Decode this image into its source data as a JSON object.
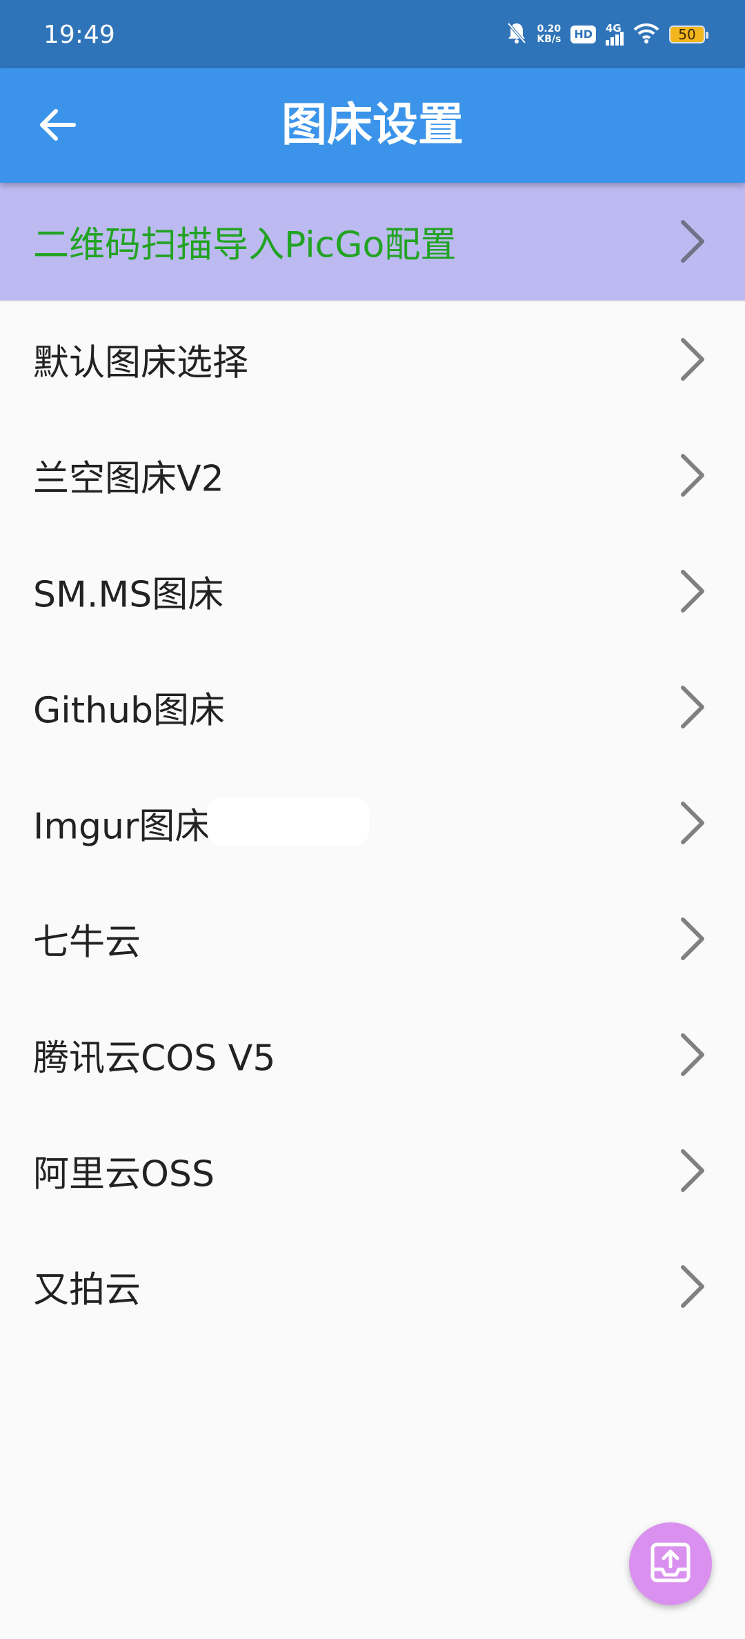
{
  "status_bar": {
    "time": "19:49",
    "net_speed_value": "0.20",
    "net_speed_unit": "KB/s",
    "hd_label": "HD",
    "signal_label": "4G",
    "battery_level": "50",
    "icons": [
      "mute-bell-icon",
      "hd-icon",
      "signal-icon",
      "wifi-icon",
      "battery-icon"
    ]
  },
  "app_bar": {
    "title": "图床设置",
    "back_icon": "back-arrow-icon"
  },
  "list": {
    "items": [
      {
        "label": "二维码扫描导入PicGo配置",
        "highlight": true
      },
      {
        "label": "默认图床选择"
      },
      {
        "label": "兰空图床V2"
      },
      {
        "label": "SM.MS图床"
      },
      {
        "label": "Github图床"
      },
      {
        "label": "Imgur图床"
      },
      {
        "label": "七牛云"
      },
      {
        "label": "腾讯云COS V5"
      },
      {
        "label": "阿里云OSS"
      },
      {
        "label": "又拍云"
      }
    ]
  },
  "fab": {
    "icon": "upload-tray-icon"
  },
  "colors": {
    "status_bar": "#2f74b9",
    "app_bar": "#3b94ea",
    "highlight_bg": "#bcbaf0",
    "highlight_text": "#22a323",
    "fab": "#d990ee",
    "chevron": "#808080"
  }
}
